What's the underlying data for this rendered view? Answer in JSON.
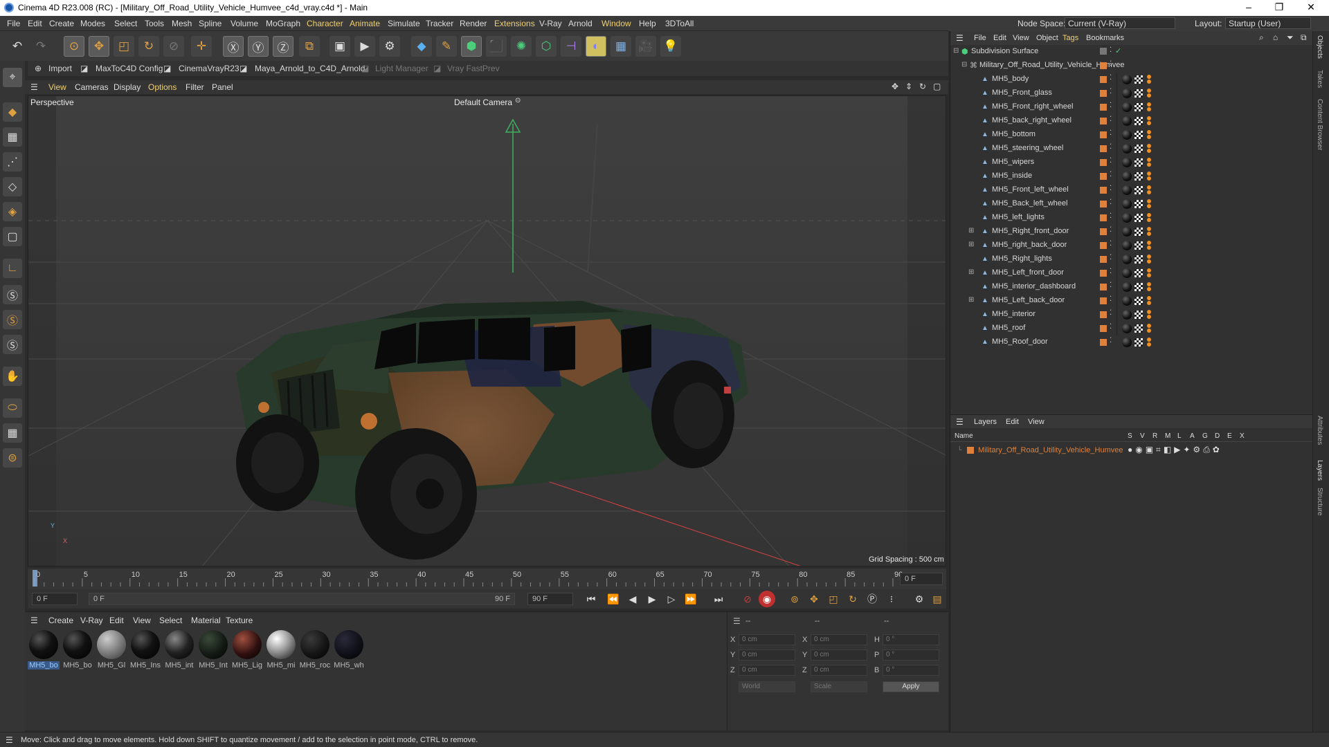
{
  "window": {
    "title": "Cinema 4D R23.008 (RC) - [Military_Off_Road_Utility_Vehicle_Humvee_c4d_vray.c4d *] - Main",
    "controls": [
      "–",
      "❐",
      "✕"
    ]
  },
  "menubar": {
    "items": [
      "File",
      "Edit",
      "Create",
      "Modes",
      "Select",
      "Tools",
      "Mesh",
      "Spline",
      "Volume",
      "MoGraph",
      "Character",
      "Animate",
      "Simulate",
      "Tracker",
      "Render",
      "Extensions",
      "V-Ray",
      "Arnold",
      "Window",
      "Help",
      "3DToAll"
    ],
    "node_space_label": "Node Space:",
    "node_space_value": "Current (V-Ray)",
    "layout_label": "Layout:",
    "layout_value": "Startup (User)"
  },
  "plugins": {
    "items": [
      "Import",
      "MaxToC4D Config",
      "CinemaVrayR23",
      "Maya_Arnold_to_C4D_Arnold",
      "Light Manager",
      "Vray FastPrev"
    ]
  },
  "viewport": {
    "menu": [
      "View",
      "Cameras",
      "Display",
      "Options",
      "Filter",
      "Panel"
    ],
    "view_name": "Perspective",
    "camera": "Default Camera",
    "camera_icon": "⊙",
    "grid_spacing": "Grid Spacing : 500 cm",
    "axis_y": "Y",
    "axis_x": "X"
  },
  "timeline": {
    "ticks": [
      "0",
      "5",
      "10",
      "15",
      "20",
      "25",
      "30",
      "35",
      "40",
      "45",
      "50",
      "55",
      "60",
      "65",
      "70",
      "75",
      "80",
      "85",
      "90"
    ],
    "current_frame": "0 F",
    "start_field": "0 F",
    "range_start": "0 F",
    "range_end": "90 F",
    "end_field": "90 F"
  },
  "materials": {
    "menu": [
      "Create",
      "V-Ray",
      "Edit",
      "View",
      "Select",
      "Material",
      "Texture"
    ],
    "items": [
      "MH5_bo",
      "MH5_bo",
      "MH5_Gl",
      "MH5_Ins",
      "MH5_int",
      "MH5_Int",
      "MH5_Lig",
      "MH5_mi",
      "MH5_roc",
      "MH5_wh"
    ]
  },
  "attributes": {
    "labels": [
      "X",
      "Y",
      "Z",
      "X",
      "Y",
      "Z",
      "H",
      "P",
      "B"
    ],
    "col_headers": [
      "--",
      "--",
      "--"
    ],
    "pos": [
      "0 cm",
      "0 cm",
      "0 cm"
    ],
    "size": [
      "0 cm",
      "0 cm",
      "0 cm"
    ],
    "rot": [
      "0 °",
      "0 °",
      "0 °"
    ],
    "coord_mode": "World",
    "scale_mode": "Scale",
    "apply": "Apply"
  },
  "objects": {
    "menu": [
      "File",
      "Edit",
      "View",
      "Object",
      "Tags",
      "Bookmarks"
    ],
    "root": "Subdivision Surface",
    "group": "Military_Off_Road_Utility_Vehicle_Humvee",
    "children": [
      "MH5_body",
      "MH5_Front_glass",
      "MH5_Front_right_wheel",
      "MH5_back_right_wheel",
      "MH5_bottom",
      "MH5_steering_wheel",
      "MH5_wipers",
      "MH5_inside",
      "MH5_Front_left_wheel",
      "MH5_Back_left_wheel",
      "MH5_left_lights",
      "MH5_Right_front_door",
      "MH5_right_back_door",
      "MH5_Right_lights",
      "MH5_Left_front_door",
      "MH5_interior_dashboard",
      "MH5_Left_back_door",
      "MH5_interior",
      "MH5_roof",
      "MH5_Roof_door"
    ]
  },
  "layers": {
    "menu": [
      "Layers",
      "Edit",
      "View"
    ],
    "name_header": "Name",
    "flags": [
      "S",
      "V",
      "R",
      "M",
      "L",
      "A",
      "G",
      "D",
      "E",
      "X"
    ],
    "layer_name": "Military_Off_Road_Utility_Vehicle_Humvee"
  },
  "side_tabs": [
    "Objects",
    "Takes",
    "Content Browser",
    "Attributes",
    "Layers",
    "Structure"
  ],
  "status": "Move: Click and drag to move elements. Hold down SHIFT to quantize movement / add to the selection in point mode, CTRL to remove.",
  "colors": {
    "accent": "#e0803a",
    "highlight": "#f0d070",
    "viewport_bg": "#3d3d3d"
  }
}
